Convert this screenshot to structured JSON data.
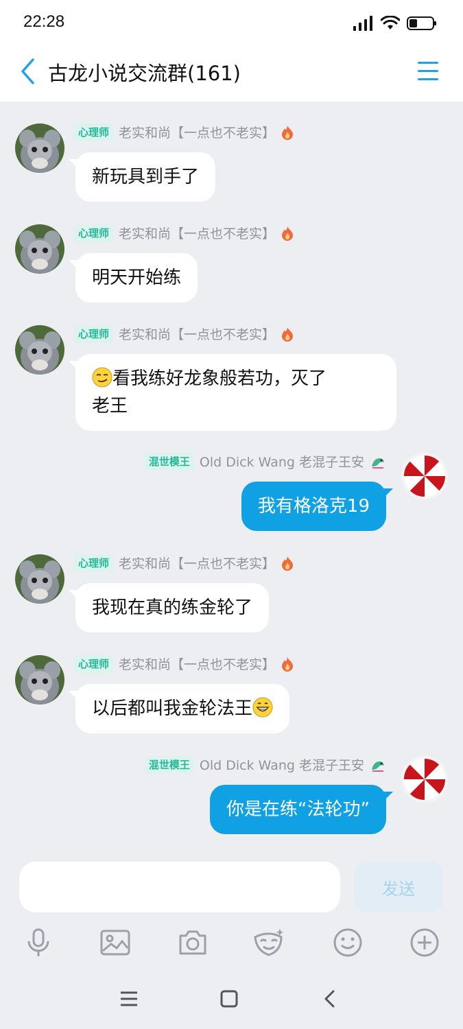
{
  "status": {
    "time": "22:28"
  },
  "header": {
    "title": "古龙小说交流群(161)"
  },
  "messages": [
    {
      "side": "left",
      "badge": "心理师",
      "sender": "老实和尚【一点也不老实】",
      "text": "新玩具到手了"
    },
    {
      "side": "left",
      "badge": "心理师",
      "sender": "老实和尚【一点也不老实】",
      "text": "明天开始练"
    },
    {
      "side": "left",
      "badge": "心理师",
      "sender": "老实和尚【一点也不老实】",
      "text_line1": "看我练好龙象般若功，灭了",
      "text_line2": "老王"
    },
    {
      "side": "right",
      "badge": "混世模王",
      "sender": "Old Dick Wang 老混子王安",
      "text": "我有格洛克19"
    },
    {
      "side": "left",
      "badge": "心理师",
      "sender": "老实和尚【一点也不老实】",
      "text": "我现在真的练金轮了"
    },
    {
      "side": "left",
      "badge": "心理师",
      "sender": "老实和尚【一点也不老实】",
      "text": "以后都叫我金轮法王"
    },
    {
      "side": "right",
      "badge": "混世模王",
      "sender": "Old Dick Wang 老混子王安",
      "text": "你是在练“法轮功”"
    }
  ],
  "input": {
    "send_label": "发送"
  },
  "colors": {
    "accent": "#0fa1e4",
    "badge_bg": "#dcf3ee",
    "badge_text": "#25b99a"
  }
}
